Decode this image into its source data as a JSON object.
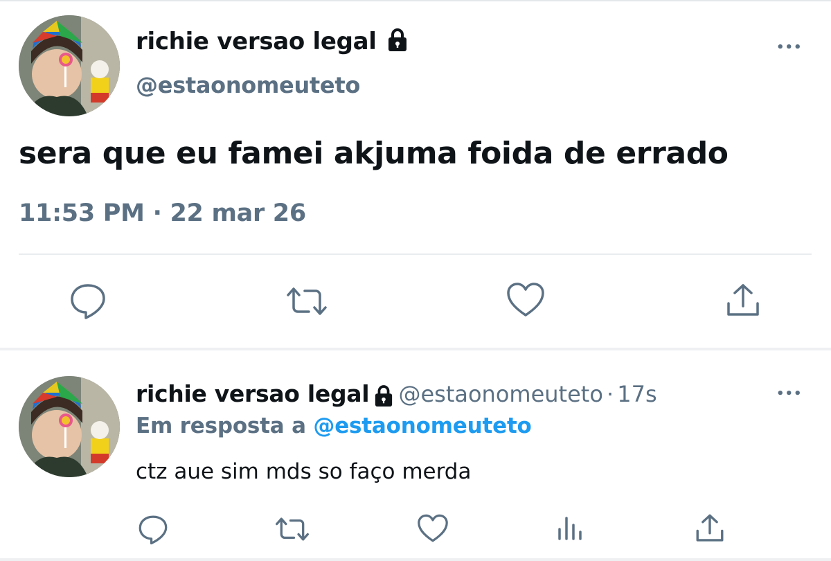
{
  "main_tweet": {
    "display_name": "richie versao legal",
    "handle": "@estaonomeuteto",
    "text": "sera que eu famei akjuma foida de errado",
    "time": "11:53 PM",
    "separator": "·",
    "date": "22 mar 26",
    "more_label": "•••",
    "icons": [
      "reply-icon",
      "retweet-icon",
      "like-icon",
      "share-icon"
    ]
  },
  "reply_tweet": {
    "display_name": "richie versao legal",
    "handle": "@estaonomeuteto",
    "separator": "·",
    "age": "17s",
    "reply_prefix": "Em resposta a",
    "reply_target": "@estaonomeuteto",
    "text": "ctz aue sim mds so faço merda",
    "more_label": "•••",
    "icons": [
      "reply-icon",
      "retweet-icon",
      "like-icon",
      "analytics-icon",
      "share-icon"
    ]
  },
  "colors": {
    "text_primary": "#0f1419",
    "text_secondary": "#5b7083",
    "link": "#1d9bf0",
    "divider": "#e9ecef"
  }
}
